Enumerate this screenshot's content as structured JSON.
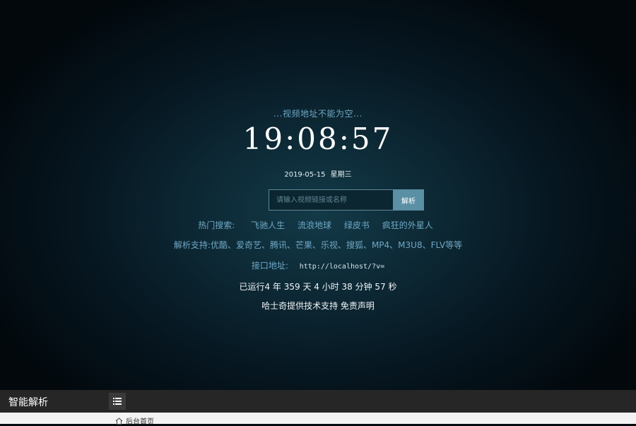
{
  "hero": {
    "notice": "...视频地址不能为空...",
    "clock": "19:08:57",
    "date": "2019-05-15",
    "weekday": "星期三",
    "search": {
      "placeholder": "请输入视频链接或名称",
      "button_label": "解析"
    },
    "hot_search": {
      "label": "热门搜索:",
      "items": [
        "飞驰人生",
        "流浪地球",
        "绿皮书",
        "疯狂的外星人"
      ]
    },
    "support": {
      "label": "解析支持:",
      "text": "优酷、爱奇艺、腾讯、芒果、乐视、搜狐、MP4、M3U8、FLV等等"
    },
    "api": {
      "label": "接口地址:",
      "url": "http://localhost/?v="
    },
    "uptime": "已运行4 年 359 天 4 小时 38 分钟 57 秒",
    "credit": "哈士奇提供技术支持",
    "disclaimer": "免责声明"
  },
  "admin": {
    "brand": "智能解析",
    "home_tab": "后台首页"
  },
  "colors": {
    "accent": "#6fa7c4",
    "button": "#5a8fa4",
    "topbar": "#262626"
  },
  "icons": {
    "menu": "menu-list-icon",
    "home": "home-icon"
  }
}
